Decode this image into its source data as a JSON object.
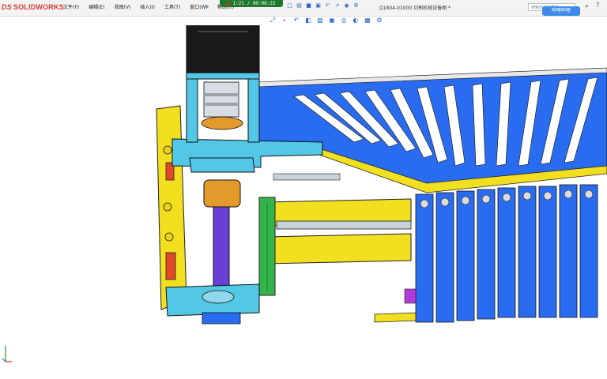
{
  "app": {
    "logo_prefix": "DS",
    "logo_text": "SOLIDWORKS",
    "document_title": "Q1804-01000 切割机械设备图 *",
    "timer": "1:21 / 00:06:22"
  },
  "menu": {
    "items": [
      {
        "label": "文件(F)"
      },
      {
        "label": "编辑(E)"
      },
      {
        "label": "视图(V)"
      },
      {
        "label": "插入(I)"
      },
      {
        "label": "工具(T)"
      },
      {
        "label": "窗口(W)"
      },
      {
        "label": "帮助(H)"
      }
    ]
  },
  "search": {
    "placeholder": "搜索命令等帮助"
  },
  "badge": {
    "label": "哔哩哔哩"
  },
  "icons": {
    "pin": "pin-icon",
    "search": "search-icon",
    "triad": "axis-triad-icon"
  },
  "colors": {
    "frame_yellow": "#f2df1f",
    "plate_blue": "#2a6cf0",
    "motor_black": "#1a1a1a",
    "cyan_part": "#53c7e6",
    "copper": "#e39a2a",
    "rod_purple": "#6a3fd6",
    "green_rail": "#32b44a",
    "red_accent": "#d63a2e"
  }
}
